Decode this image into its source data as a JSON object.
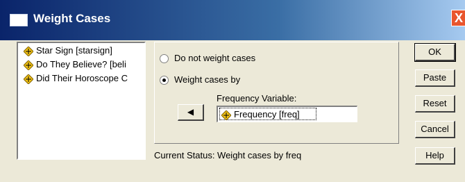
{
  "window": {
    "title": "Weight Cases",
    "close_label": "X"
  },
  "variables": [
    {
      "label": "Star Sign [starsign]",
      "icon": "ruler-scale-icon"
    },
    {
      "label": "Do They Believe? [beli",
      "icon": "ruler-scale-icon"
    },
    {
      "label": "Did Their Horoscope C",
      "icon": "ruler-scale-icon"
    }
  ],
  "options": {
    "do_not_weight": {
      "label": "Do not weight cases",
      "selected": false
    },
    "weight_by": {
      "label": "Weight cases by",
      "selected": true
    }
  },
  "frequency": {
    "label": "Frequency Variable:",
    "value": "Frequency [freq]",
    "arrow_glyph": "◀"
  },
  "status": "Current Status: Weight cases by freq",
  "buttons": {
    "ok": "OK",
    "paste": "Paste",
    "reset": "Reset",
    "cancel": "Cancel",
    "help": "Help"
  }
}
